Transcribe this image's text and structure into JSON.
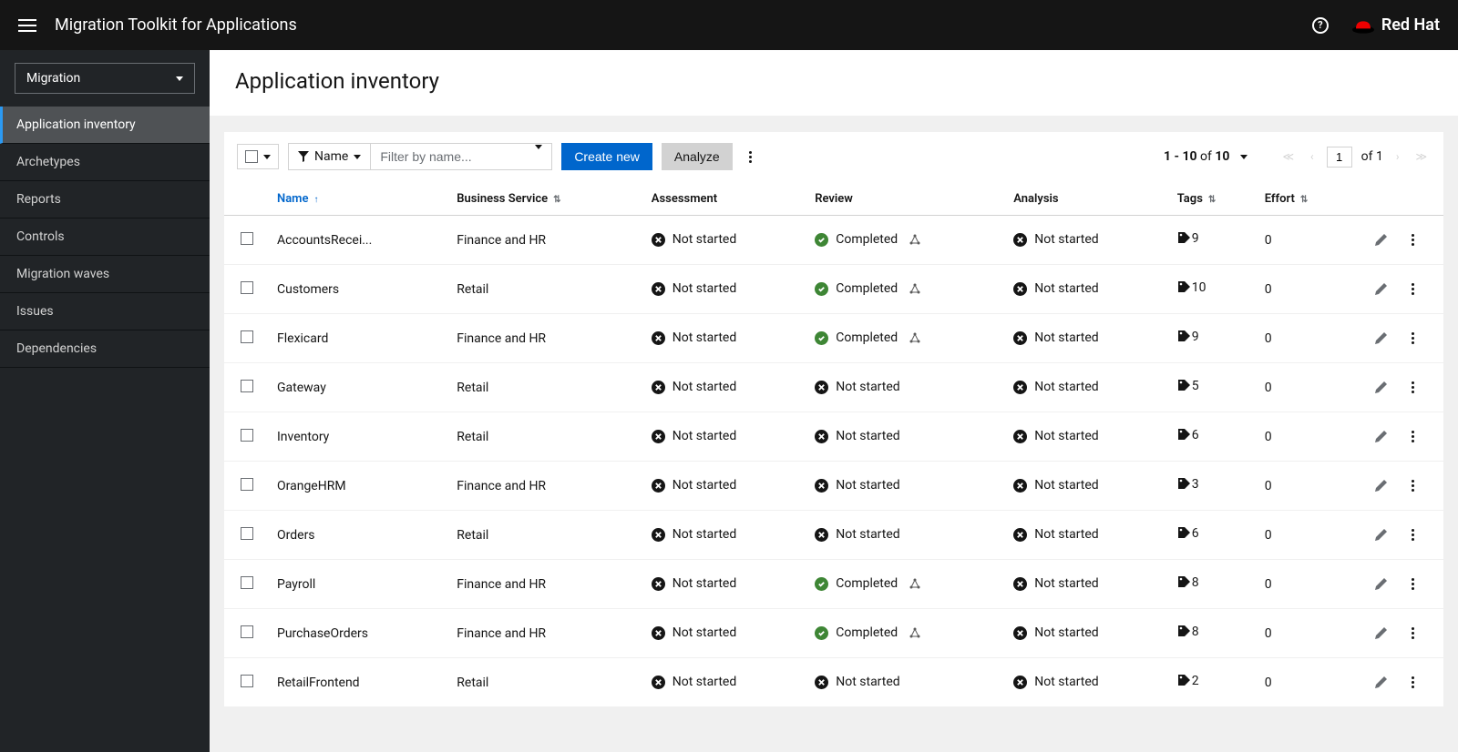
{
  "header": {
    "title": "Migration Toolkit for Applications",
    "brand": "Red Hat"
  },
  "sidebar": {
    "select": "Migration",
    "items": [
      {
        "label": "Application inventory",
        "active": true
      },
      {
        "label": "Archetypes",
        "active": false
      },
      {
        "label": "Reports",
        "active": false
      },
      {
        "label": "Controls",
        "active": false
      },
      {
        "label": "Migration waves",
        "active": false
      },
      {
        "label": "Issues",
        "active": false
      },
      {
        "label": "Dependencies",
        "active": false
      }
    ]
  },
  "page": {
    "title": "Application inventory"
  },
  "toolbar": {
    "filter_label": "Name",
    "filter_placeholder": "Filter by name...",
    "create_btn": "Create new",
    "analyze_btn": "Analyze"
  },
  "pagination": {
    "range": "1 - 10",
    "of_label": "of",
    "total": "10",
    "page": "1",
    "page_of": "of 1"
  },
  "columns": {
    "name": "Name",
    "business": "Business Service",
    "assessment": "Assessment",
    "review": "Review",
    "analysis": "Analysis",
    "tags": "Tags",
    "effort": "Effort"
  },
  "status_labels": {
    "not_started": "Not started",
    "completed": "Completed"
  },
  "rows": [
    {
      "name": "AccountsRecei...",
      "business": "Finance and HR",
      "assessment": "not_started",
      "review": "completed",
      "review_inherit": true,
      "analysis": "not_started",
      "tags": "9",
      "effort": "0"
    },
    {
      "name": "Customers",
      "business": "Retail",
      "assessment": "not_started",
      "review": "completed",
      "review_inherit": true,
      "analysis": "not_started",
      "tags": "10",
      "effort": "0"
    },
    {
      "name": "Flexicard",
      "business": "Finance and HR",
      "assessment": "not_started",
      "review": "completed",
      "review_inherit": true,
      "analysis": "not_started",
      "tags": "9",
      "effort": "0"
    },
    {
      "name": "Gateway",
      "business": "Retail",
      "assessment": "not_started",
      "review": "not_started",
      "review_inherit": false,
      "analysis": "not_started",
      "tags": "5",
      "effort": "0"
    },
    {
      "name": "Inventory",
      "business": "Retail",
      "assessment": "not_started",
      "review": "not_started",
      "review_inherit": false,
      "analysis": "not_started",
      "tags": "6",
      "effort": "0"
    },
    {
      "name": "OrangeHRM",
      "business": "Finance and HR",
      "assessment": "not_started",
      "review": "not_started",
      "review_inherit": false,
      "analysis": "not_started",
      "tags": "3",
      "effort": "0"
    },
    {
      "name": "Orders",
      "business": "Retail",
      "assessment": "not_started",
      "review": "not_started",
      "review_inherit": false,
      "analysis": "not_started",
      "tags": "6",
      "effort": "0"
    },
    {
      "name": "Payroll",
      "business": "Finance and HR",
      "assessment": "not_started",
      "review": "completed",
      "review_inherit": true,
      "analysis": "not_started",
      "tags": "8",
      "effort": "0"
    },
    {
      "name": "PurchaseOrders",
      "business": "Finance and HR",
      "assessment": "not_started",
      "review": "completed",
      "review_inherit": true,
      "analysis": "not_started",
      "tags": "8",
      "effort": "0"
    },
    {
      "name": "RetailFrontend",
      "business": "Retail",
      "assessment": "not_started",
      "review": "not_started",
      "review_inherit": false,
      "analysis": "not_started",
      "tags": "2",
      "effort": "0"
    }
  ]
}
